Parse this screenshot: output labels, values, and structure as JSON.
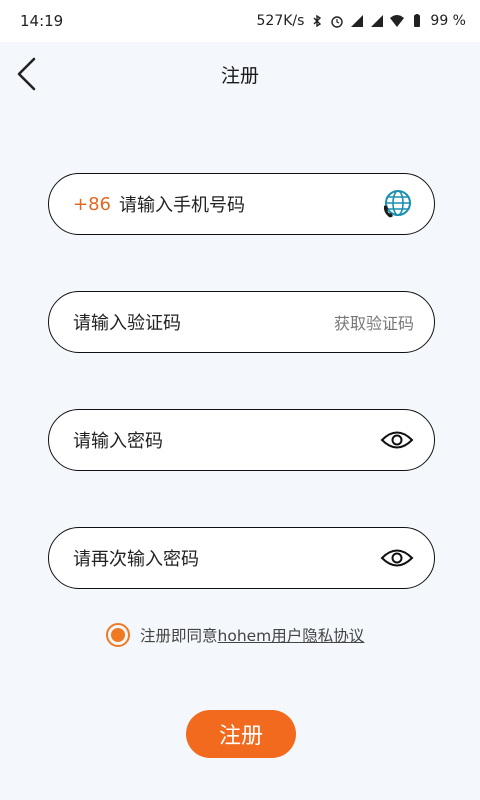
{
  "status_bar": {
    "time": "14:19",
    "net_speed": "527K/s",
    "battery": "99 %"
  },
  "header": {
    "title": "注册"
  },
  "phone_field": {
    "prefix": "+86",
    "placeholder": "请输入手机号码",
    "icon": "globe-phone-icon"
  },
  "code_field": {
    "placeholder": "请输入验证码",
    "action_label": "获取验证码"
  },
  "password_field": {
    "placeholder": "请输入密码",
    "icon": "eye-icon"
  },
  "confirm_password_field": {
    "placeholder": "请再次输入密码",
    "icon": "eye-icon"
  },
  "agreement": {
    "prefix_text": "注册即同意",
    "link_text": "hohem用户隐私协议",
    "checked": true
  },
  "register_button": {
    "label": "注册"
  },
  "colors": {
    "accent": "#f26a1e",
    "background": "#f4f7fb",
    "globe": "#1a8fb0"
  }
}
